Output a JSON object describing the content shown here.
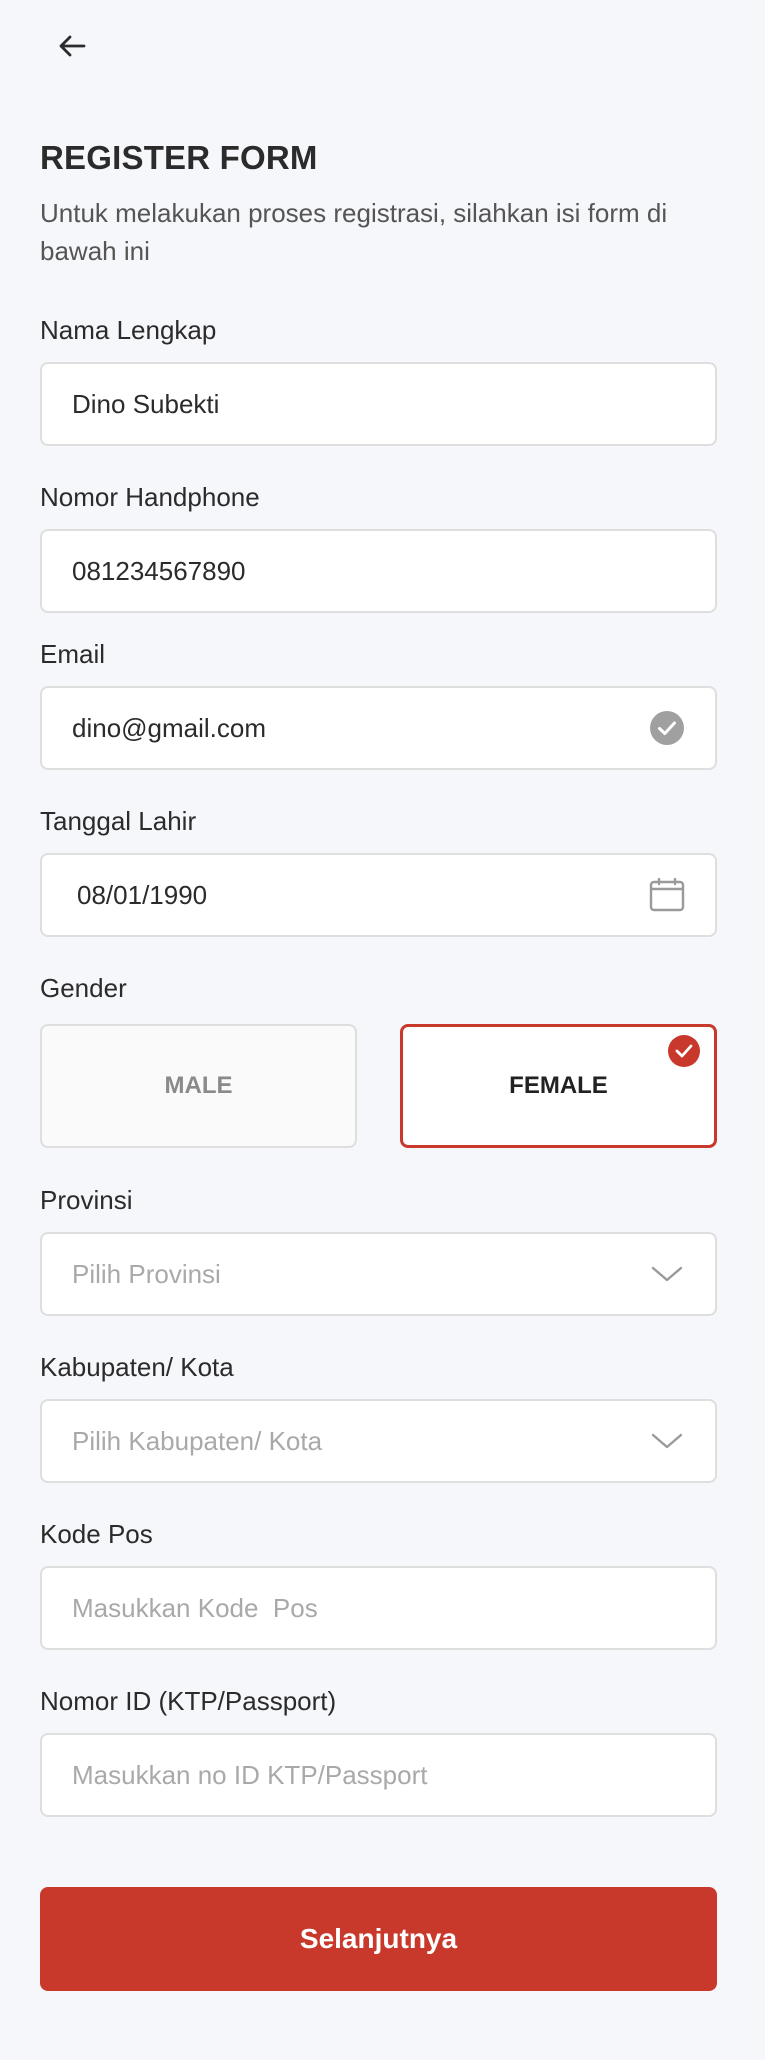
{
  "header": {
    "back_icon": "arrow-left-icon"
  },
  "form": {
    "title": "REGISTER FORM",
    "subtitle": "Untuk melakukan proses registrasi, silahkan isi form di bawah ini",
    "full_name": {
      "label": "Nama Lengkap",
      "value": "Dino Subekti"
    },
    "phone": {
      "label": "Nomor Handphone",
      "value": "081234567890"
    },
    "email": {
      "label": "Email",
      "value": "dino@gmail.com",
      "status_icon": "check-circle-icon"
    },
    "birth_date": {
      "label": "Tanggal Lahir",
      "value": "08/01/1990",
      "icon": "calendar-icon"
    },
    "gender": {
      "label": "Gender",
      "options": [
        "MALE",
        "FEMALE"
      ],
      "selected": "FEMALE"
    },
    "province": {
      "label": "Provinsi",
      "placeholder": "Pilih Provinsi",
      "icon": "chevron-down-icon"
    },
    "city": {
      "label": "Kabupaten/ Kota",
      "placeholder": "Pilih Kabupaten/ Kota",
      "icon": "chevron-down-icon"
    },
    "postal_code": {
      "label": "Kode Pos",
      "placeholder": "Masukkan Kode  Pos"
    },
    "id_number": {
      "label": "Nomor ID (KTP/Passport)",
      "placeholder": "Masukkan no ID KTP/Passport"
    },
    "submit_label": "Selanjutnya"
  },
  "colors": {
    "accent": "#c9392b",
    "background": "#f6f7fb",
    "border": "#dedede",
    "placeholder": "#a9a9a9"
  }
}
